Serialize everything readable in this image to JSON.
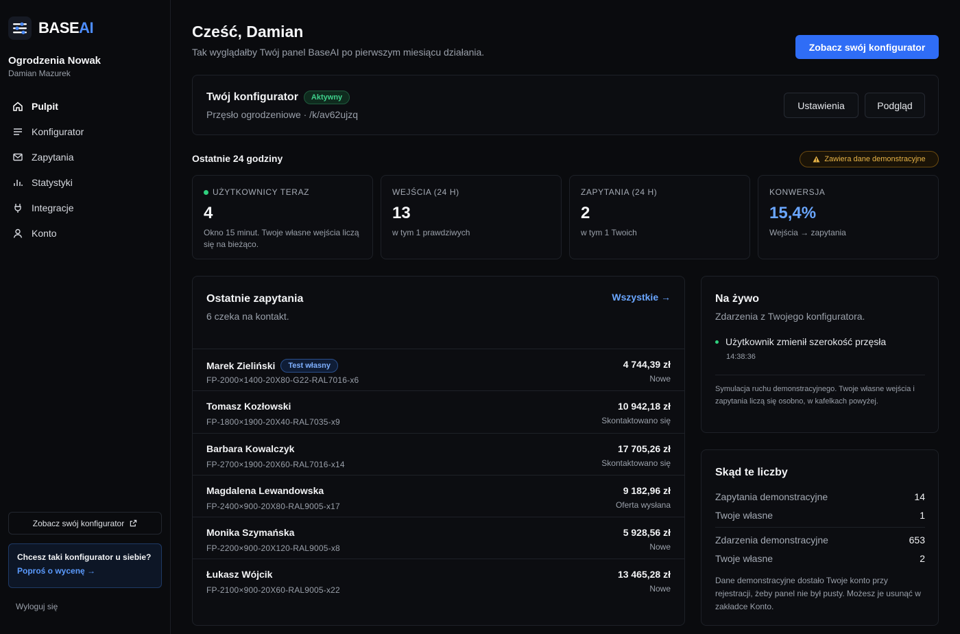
{
  "brand": {
    "name_main": "BASE",
    "name_accent": "AI"
  },
  "account": {
    "company": "Ogrodzenia Nowak",
    "user": "Damian Mazurek"
  },
  "nav": [
    {
      "label": "Pulpit",
      "icon": "home-icon",
      "active": true
    },
    {
      "label": "Konfigurator",
      "icon": "list-icon",
      "active": false
    },
    {
      "label": "Zapytania",
      "icon": "mail-icon",
      "active": false
    },
    {
      "label": "Statystyki",
      "icon": "bar-chart-icon",
      "active": false
    },
    {
      "label": "Integracje",
      "icon": "plug-icon",
      "active": false
    },
    {
      "label": "Konto",
      "icon": "user-icon",
      "active": false
    }
  ],
  "sidebar_cta": {
    "label": "Zobacz swój konfigurator",
    "icon": "external-link-icon"
  },
  "promo": {
    "title": "Chcesz taki konfigurator u siebie?",
    "link": "Poproś o wycenę →"
  },
  "logout": "Wyloguj się",
  "header": {
    "greeting": "Cześć, Damian",
    "subtitle": "Tak wyglądałby Twój panel BaseAI po pierwszym miesiącu działania.",
    "primary_button": "Zobacz swój konfigurator"
  },
  "configurator": {
    "title": "Twój konfigurator",
    "status": "Aktywny",
    "subtitle": "Przęsło ogrodzeniowe · /k/av62ujzq",
    "settings_button": "Ustawienia",
    "preview_button": "Podgląd"
  },
  "section": {
    "label": "Ostatnie 24 godziny",
    "demo_badge": "Zawiera dane demonstracyjne",
    "colors": {
      "warning": "#e8b447",
      "accent": "#2f6df6",
      "live": "#2fd07e"
    }
  },
  "kpis": [
    {
      "label": "UŻYTKOWNICY TERAZ",
      "value": "4",
      "note": "Okno 15 minut. Twoje własne wejścia liczą się na bieżąco.",
      "live_dot": true,
      "highlight": false
    },
    {
      "label": "WEJŚCIA (24 H)",
      "value": "13",
      "note": "w tym 1 prawdziwych",
      "live_dot": false,
      "highlight": false
    },
    {
      "label": "ZAPYTANIA (24 H)",
      "value": "2",
      "note": "w tym 1 Twoich",
      "live_dot": false,
      "highlight": false
    },
    {
      "label": "KONWERSJA",
      "value": "15,4%",
      "note": "Wejścia → zapytania",
      "live_dot": false,
      "highlight": true
    }
  ],
  "requests": {
    "title": "Ostatnie zapytania",
    "subtitle": "6 czeka na kontakt.",
    "all_link": "Wszystkie →",
    "rows": [
      {
        "name": "Marek Zieliński",
        "badge": "Test własny",
        "code": "FP-2000×1400-20X80-G22-RAL7016-x6",
        "amount": "4 744,39 zł",
        "status": "Nowe"
      },
      {
        "name": "Tomasz Kozłowski",
        "badge": "",
        "code": "FP-1800×1900-20X40-RAL7035-x9",
        "amount": "10 942,18 zł",
        "status": "Skontaktowano się"
      },
      {
        "name": "Barbara Kowalczyk",
        "badge": "",
        "code": "FP-2700×1900-20X60-RAL7016-x14",
        "amount": "17 705,26 zł",
        "status": "Skontaktowano się"
      },
      {
        "name": "Magdalena Lewandowska",
        "badge": "",
        "code": "FP-2400×900-20X80-RAL9005-x17",
        "amount": "9 182,96 zł",
        "status": "Oferta wysłana"
      },
      {
        "name": "Monika Szymańska",
        "badge": "",
        "code": "FP-2200×900-20X120-RAL9005-x8",
        "amount": "5 928,56 zł",
        "status": "Nowe"
      },
      {
        "name": "Łukasz Wójcik",
        "badge": "",
        "code": "FP-2100×900-20X60-RAL9005-x22",
        "amount": "13 465,28 zł",
        "status": "Nowe"
      }
    ]
  },
  "live": {
    "title": "Na żywo",
    "subtitle": "Zdarzenia z Twojego konfiguratora.",
    "event": "Użytkownik zmienił szerokość przęsła",
    "event_time": "14:38:36",
    "note": "Symulacja ruchu demonstracyjnego. Twoje własne wejścia i zapytania liczą się osobno, w kafelkach powyżej."
  },
  "sources": {
    "title": "Skąd te liczby",
    "rows": [
      {
        "label": "Zapytania demonstracyjne",
        "value": "14"
      },
      {
        "label": "Twoje własne",
        "value": "1"
      },
      {
        "label": "Zdarzenia demonstracyjne",
        "value": "653"
      },
      {
        "label": "Twoje własne",
        "value": "2"
      }
    ],
    "note": "Dane demonstracyjne dostało Twoje konto przy rejestracji, żeby panel nie był pusty. Możesz je usunąć w zakładce Konto."
  }
}
